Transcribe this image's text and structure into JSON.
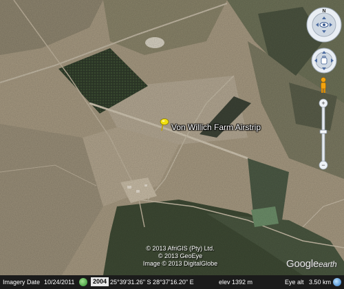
{
  "placemark": {
    "label": "Von Willich Farm Airstrip",
    "pin_color": "#f0e010"
  },
  "copyright": [
    "© 2013 AfriGIS (Pty) Ltd.",
    "© 2013 GeoEye",
    "Image © 2013 DigitalGlobe"
  ],
  "logo": {
    "google": "Google",
    "earth": "earth"
  },
  "status_bar": {
    "imagery_date_label": "Imagery Date",
    "imagery_date": "10/24/2011",
    "year": "2004",
    "coordinates": "25°39'31.26\" S   28°37'16.20\" E",
    "elevation": "elev  1392 m",
    "eye_alt_label": "Eye alt",
    "eye_alt": "3.50 km"
  },
  "controls": {
    "look_icon": "look-around-icon",
    "move_icon": "pan-icon",
    "pegman_icon": "street-view-pegman-icon",
    "zoom_in": "+",
    "zoom_out": "−"
  },
  "colors": {
    "terrain": "#a99c84",
    "dark_field": "#3d4a35",
    "road": "#c9bfae"
  }
}
